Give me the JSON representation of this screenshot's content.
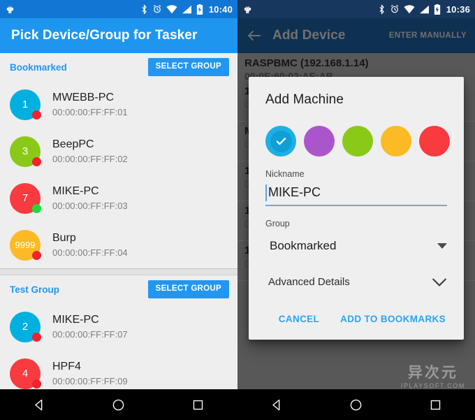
{
  "left_panel": {
    "status_bar": {
      "icons": [
        "android-robot-icon",
        "bluetooth-icon",
        "alarm-icon",
        "wifi-icon",
        "signal-icon",
        "battery-charging-icon"
      ],
      "clock": "10:40"
    },
    "toolbar": {
      "title": "Pick Device/Group for Tasker"
    },
    "sections": [
      {
        "name": "Bookmarked",
        "select_button": "SELECT GROUP",
        "rows": [
          {
            "badge": "1",
            "avatar_color": "#00b0e0",
            "status_color": "#f4212e",
            "title": "MWEBB-PC",
            "subtitle": "00:00:00:FF:FF:01"
          },
          {
            "badge": "3",
            "avatar_color": "#8bc919",
            "status_color": "#f4212e",
            "title": "BeepPC",
            "subtitle": "00:00:00:FF:FF:02"
          },
          {
            "badge": "7",
            "avatar_color": "#f93a3f",
            "status_color": "#1ddb3c",
            "title": "MIKE-PC",
            "subtitle": "00:00:00:FF:FF:03"
          },
          {
            "badge": "9999",
            "avatar_color": "#fcba24",
            "status_color": "#f4212e",
            "title": "Burp",
            "subtitle": "00:00:00:FF:FF:04"
          }
        ]
      },
      {
        "name": "Test Group",
        "select_button": "SELECT GROUP",
        "rows": [
          {
            "badge": "2",
            "avatar_color": "#00b0e0",
            "status_color": "#f4212e",
            "title": "MIKE-PC",
            "subtitle": "00:00:00:FF:FF:07"
          },
          {
            "badge": "4",
            "avatar_color": "#f93a3f",
            "status_color": "#f4212e",
            "title": "HPF4",
            "subtitle": "00:00:00:FF:FF:09"
          }
        ]
      }
    ]
  },
  "right_panel": {
    "status_bar": {
      "icons": [
        "android-robot-icon",
        "bluetooth-icon",
        "alarm-icon",
        "wifi-icon",
        "signal-icon",
        "battery-charging-icon"
      ],
      "clock": "10:36"
    },
    "toolbar": {
      "back": "back-arrow-icon",
      "title": "Add Device",
      "action": "ENTER MANUALLY"
    },
    "background_list": {
      "header_title": "RASPBMC (192.168.1.14)",
      "header_sub": "00:0E:60:02:AE:AB",
      "rows": [
        {
          "title": "1",
          "subtitle": "0"
        },
        {
          "title": "M",
          "subtitle": "0"
        },
        {
          "title": "1",
          "subtitle": "0"
        },
        {
          "title": "1",
          "subtitle": "0"
        },
        {
          "title": "1",
          "subtitle": "0"
        }
      ]
    },
    "dialog": {
      "title": "Add Machine",
      "swatches": [
        {
          "color": "#1cb0e6",
          "selected": true,
          "inner": "#0f9fd4"
        },
        {
          "color": "#ab55cd",
          "selected": false,
          "inner": ""
        },
        {
          "color": "#8bc919",
          "selected": false,
          "inner": ""
        },
        {
          "color": "#fcba24",
          "selected": false,
          "inner": ""
        },
        {
          "color": "#f93a3f",
          "selected": false,
          "inner": ""
        }
      ],
      "nickname_label": "Nickname",
      "nickname_value": "MIKE-PC",
      "nickname_placeholder": "Nickname",
      "group_label": "Group",
      "group_value": "Bookmarked",
      "advanced_label": "Advanced Details",
      "cancel_label": "CANCEL",
      "confirm_label": "ADD TO BOOKMARKS"
    }
  },
  "watermark": {
    "cn": "异次元",
    "en": "IPLAYSOFT.COM"
  },
  "navbar": {
    "back": "back-triangle-icon",
    "home": "home-circle-icon",
    "recents": "recents-square-icon"
  },
  "colors": {
    "accent_blue": "#2196f3",
    "toolbar_blue": "#1e96f0",
    "status_blue": "#1277d4",
    "toolbar_navy": "#123d66",
    "status_navy": "#17375e",
    "dialog_link": "#29a4f5"
  }
}
